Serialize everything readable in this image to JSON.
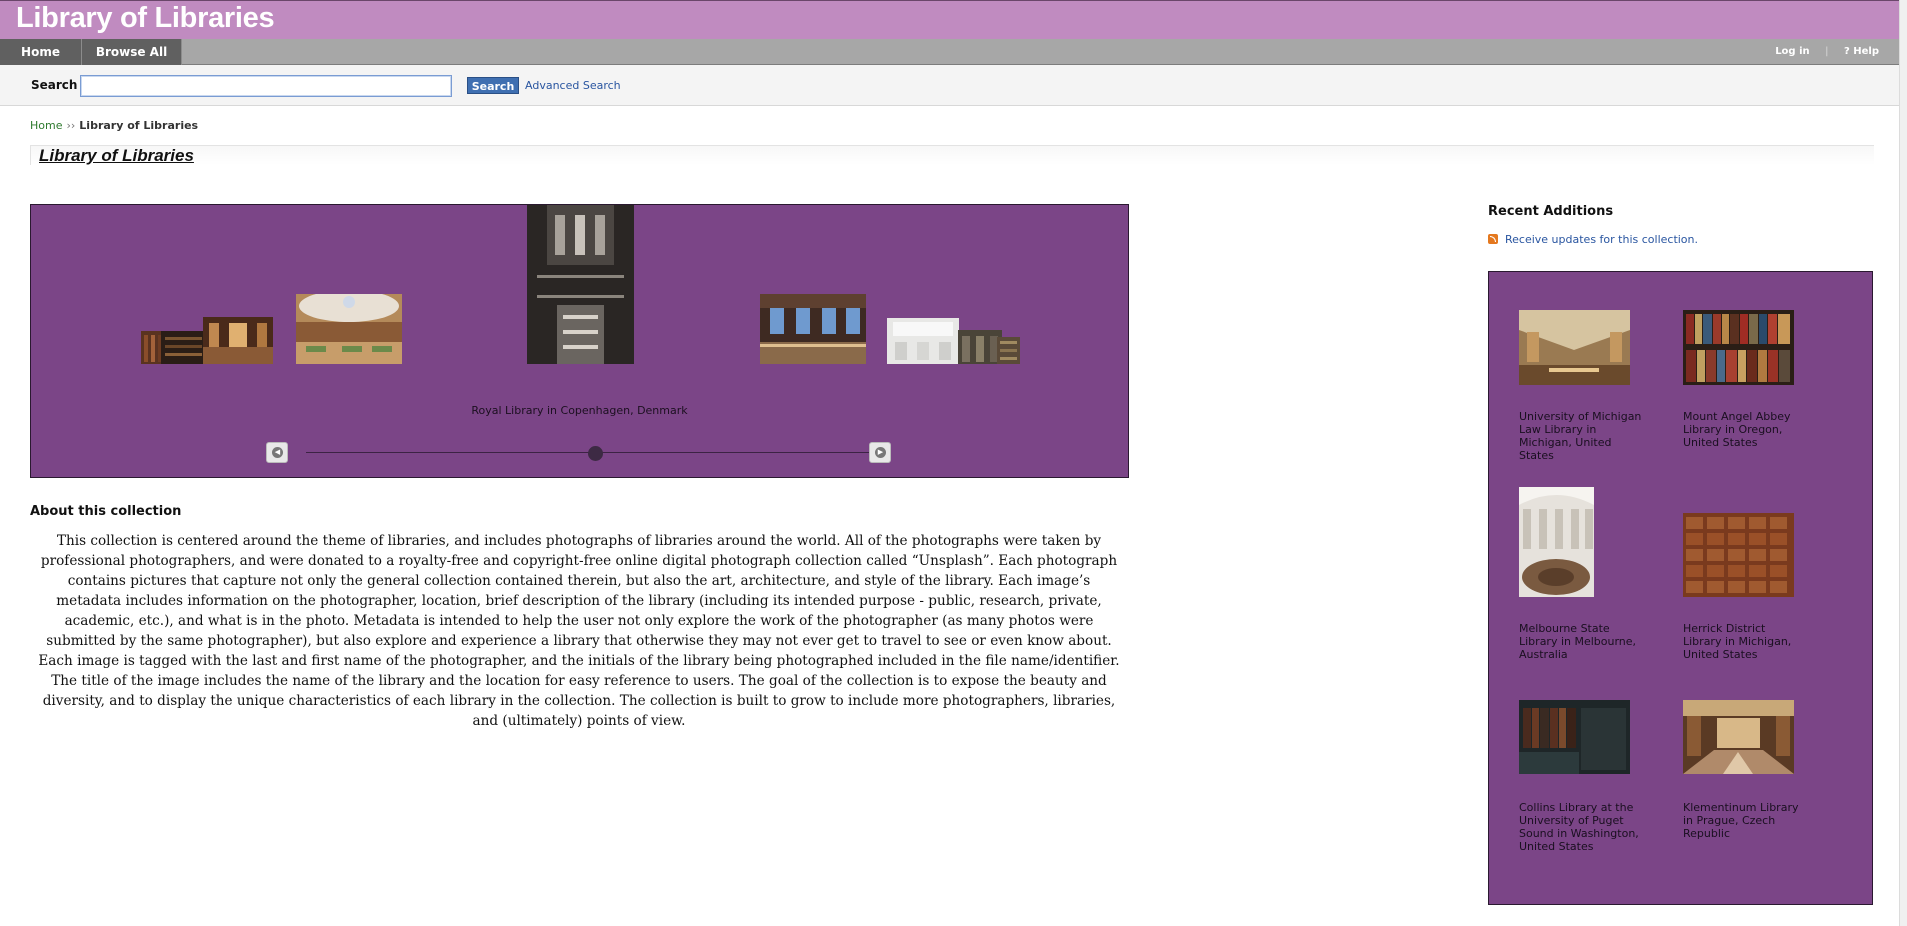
{
  "header": {
    "site_title": "Library of Libraries"
  },
  "nav": {
    "tabs": [
      {
        "label": "Home"
      },
      {
        "label": "Browse All"
      }
    ],
    "login": "Log in",
    "separator": "|",
    "help": "? Help"
  },
  "search": {
    "label": "Search",
    "value": "",
    "button": "Search",
    "advanced": "Advanced Search"
  },
  "breadcrumb": {
    "home": "Home",
    "sep": "››",
    "current": "Library of Libraries"
  },
  "page_title": "Library of Libraries",
  "carousel": {
    "caption": "Royal Library in Copenhagen, Denmark",
    "position_fraction": 0.5
  },
  "about": {
    "heading": "About this collection",
    "text": "This collection is centered around the theme of libraries, and includes photographs of libraries around the world. All of the photographs were taken by professional photographers, and were donated to a royalty-free and copyright-free online digital photograph collection called “Unsplash”. Each photograph contains pictures that capture not only the general collection contained therein, but also the art, architecture, and style of the library. Each image’s metadata includes information on the photographer, location, brief description of the library (including its intended purpose - public, research, private, academic, etc.), and what is in the photo. Metadata is intended to help the user not only explore the work of the photographer (as many photos were submitted by the same photographer), but also explore and experience a library that otherwise they may not ever get to travel to see or even know about. Each image is tagged with the last and first name of the photographer, and the initials of the library being photographed included in the file name/identifier. The title of the image includes the name of the library and the location for easy reference to users. The goal of the collection is to expose the beauty and diversity, and to display the unique characteristics of each library in the collection. The collection is built to grow to include more photographers, libraries, and (ultimately) points of view."
  },
  "recent": {
    "heading": "Recent Additions",
    "rss_link": "Receive updates for this collection.",
    "items": [
      {
        "caption": "University of Michigan Law Library in Michigan, United States"
      },
      {
        "caption": "Mount Angel Abbey Library in Oregon, United States"
      },
      {
        "caption": "Melbourne State Library in Melbourne, Australia"
      },
      {
        "caption": "Herrick District Library in Michigan, United States"
      },
      {
        "caption": "Collins Library at the University of Puget Sound in Washington, United States"
      },
      {
        "caption": "Klementinum Library in Prague, Czech Republic"
      }
    ]
  },
  "colors": {
    "header_bg": "#c08bc0",
    "panel_purple": "#7b4587",
    "nav_tab": "#606060",
    "link_blue": "#2955a0"
  }
}
